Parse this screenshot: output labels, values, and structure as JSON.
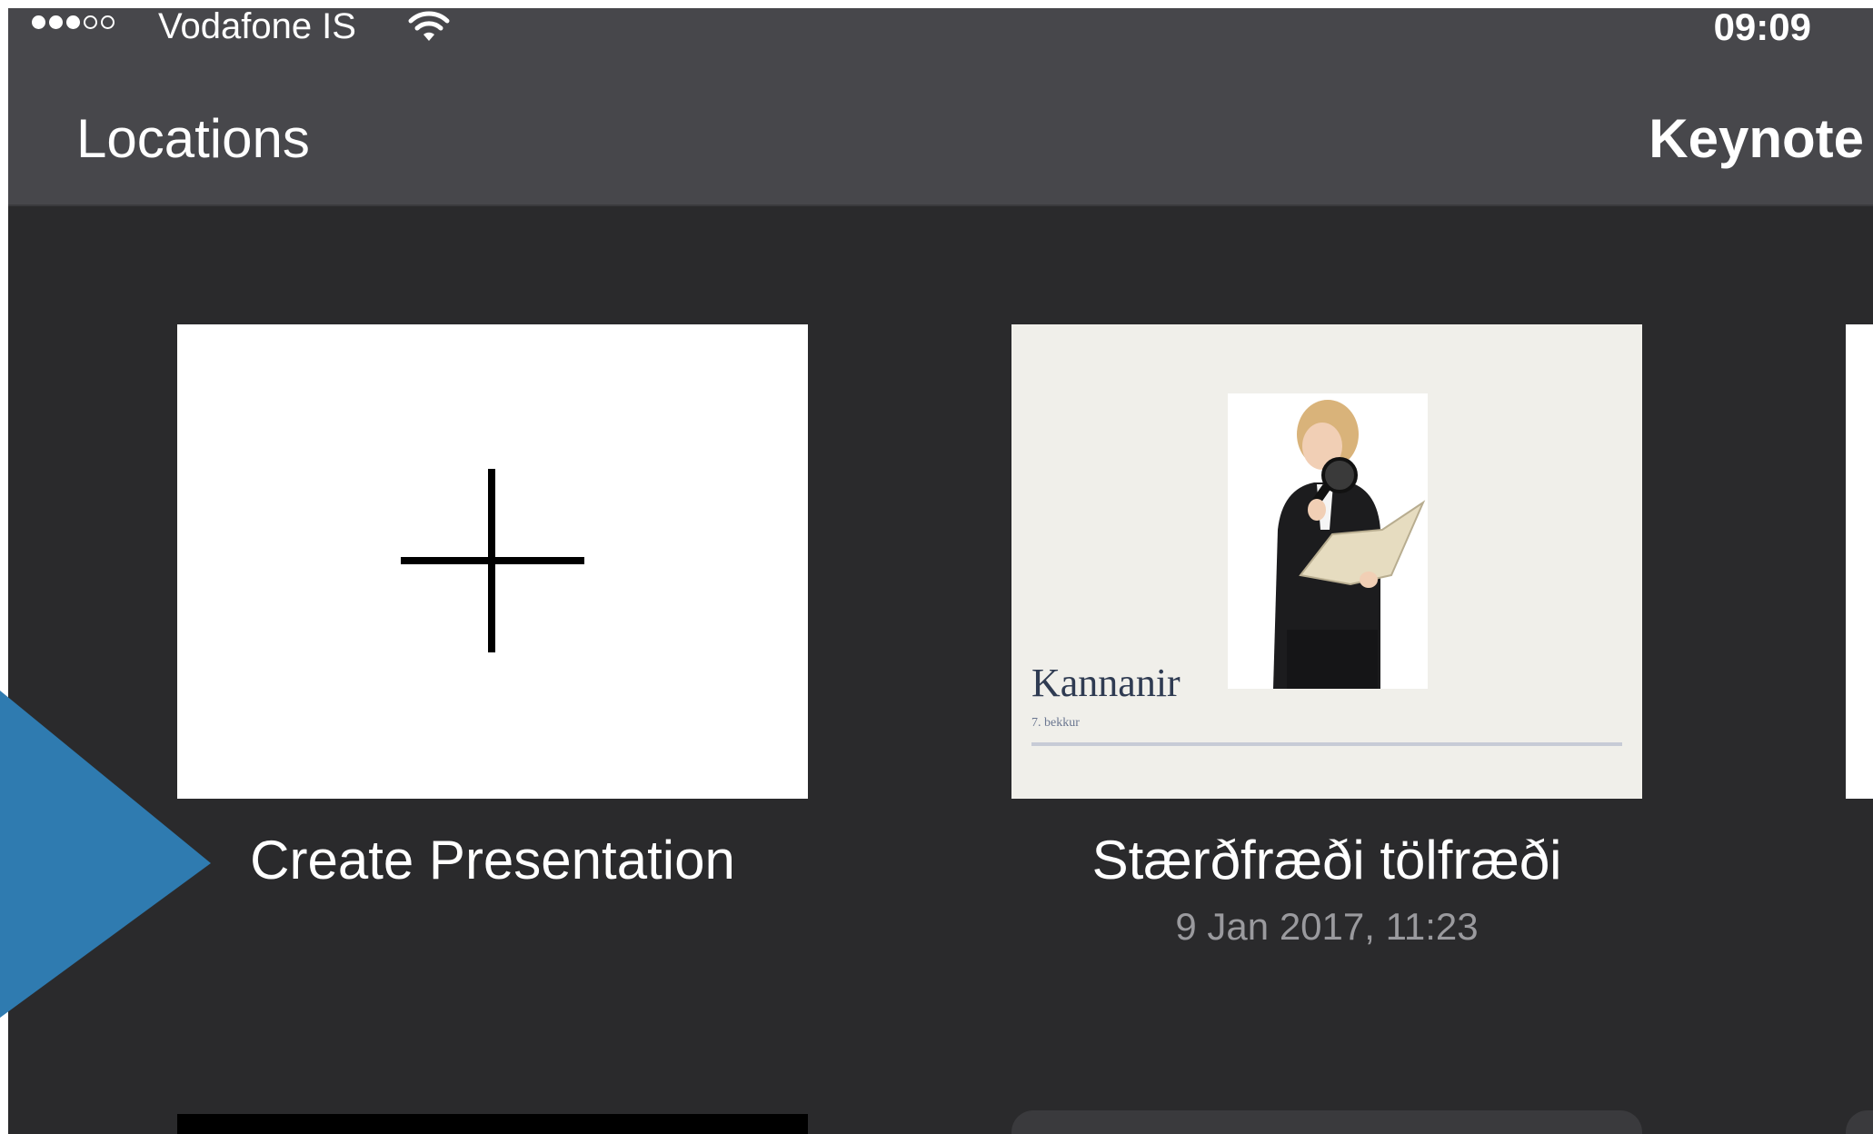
{
  "status_bar": {
    "carrier": "Vodafone IS",
    "time": "09:09",
    "signal": {
      "filled": 3,
      "total": 5
    }
  },
  "nav": {
    "back_label": "Locations",
    "title": "Keynote"
  },
  "tiles": [
    {
      "label": "Create Presentation"
    },
    {
      "label": "Stærðfræði tölfræði",
      "date": "9 Jan 2017, 11:23",
      "slide": {
        "title": "Kannanir",
        "subtitle": "7. bekkur"
      }
    }
  ],
  "colors": {
    "header_bg": "#47474b",
    "content_bg": "#2a2a2c",
    "annotation_arrow": "#2f7bb0"
  }
}
